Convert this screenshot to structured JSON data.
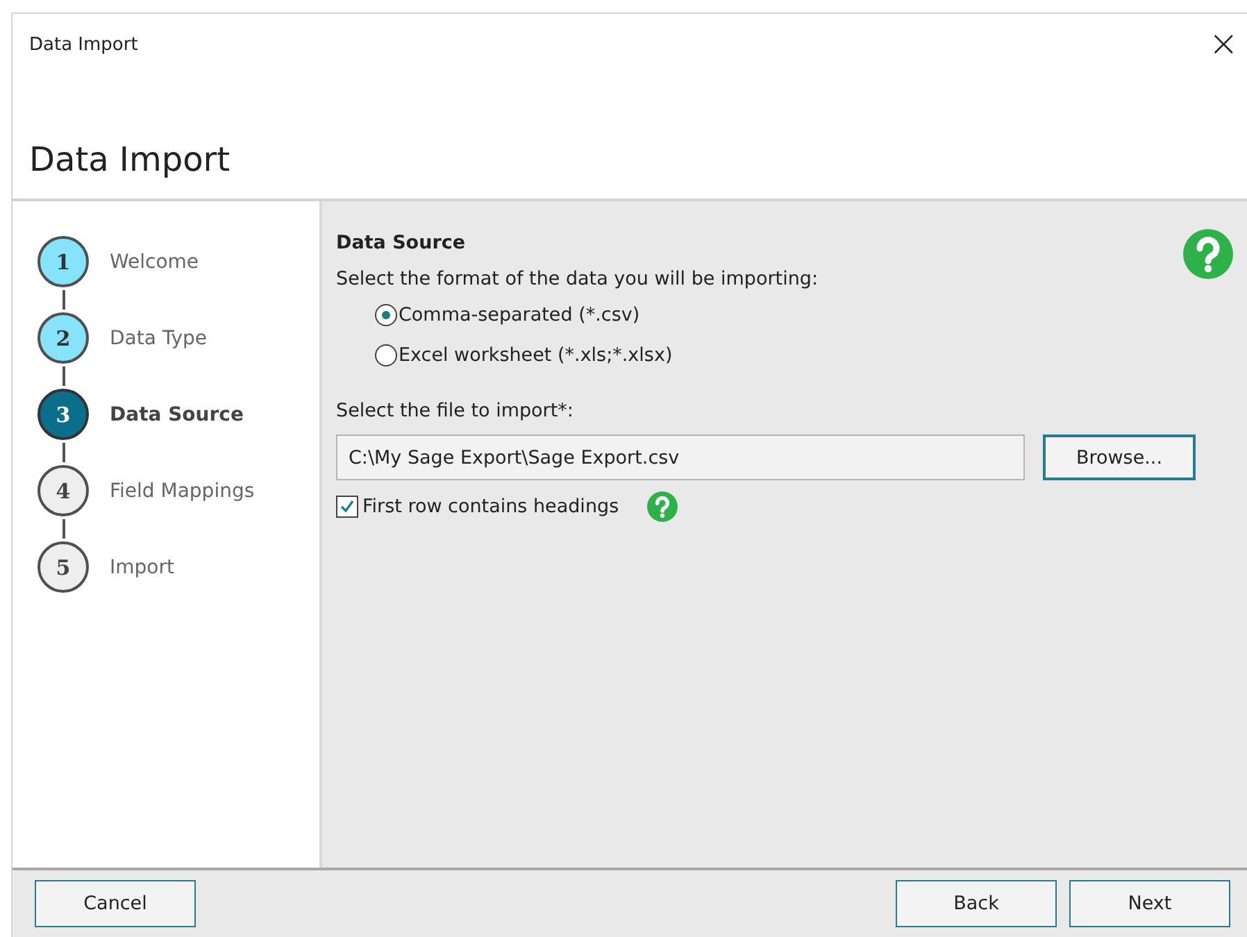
{
  "window": {
    "title": "Data Import",
    "close": "×"
  },
  "header": {
    "title": "Data Import"
  },
  "steps": [
    {
      "number": "1",
      "label": "Welcome",
      "kind": "done"
    },
    {
      "number": "2",
      "label": "Data Type",
      "kind": "done"
    },
    {
      "number": "3",
      "label": "Data Source",
      "kind": "current"
    },
    {
      "number": "4",
      "label": "Field Mappings",
      "kind": "pending"
    },
    {
      "number": "5",
      "label": "Import",
      "kind": "pending"
    }
  ],
  "section": {
    "title": "Data Source",
    "prompt": "Select the format of the data you will be importing:",
    "formats": [
      {
        "label": "Comma-separated (*.csv)",
        "selected": true
      },
      {
        "label": "Excel worksheet (*.xls;*.xlsx)",
        "selected": false
      }
    ],
    "file_label": "Select the file to import*:",
    "file_value": "C:\\My Sage Export\\Sage Export.csv",
    "browse": "Browse...",
    "headings": {
      "label": "First row contains headings",
      "checked": true
    }
  },
  "buttons": {
    "cancel": "Cancel",
    "back": "Back",
    "next": "Next"
  }
}
